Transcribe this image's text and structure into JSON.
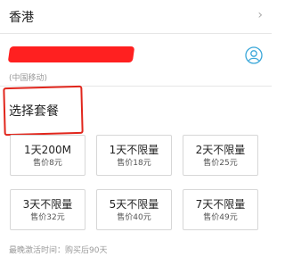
{
  "region": {
    "label": "香港",
    "chevron": "›"
  },
  "account": {
    "carrier": "(中国移动)",
    "icon": "user-circle-icon"
  },
  "plans": {
    "title": "选择套餐",
    "items": [
      {
        "name": "1天200M",
        "price": "售价8元"
      },
      {
        "name": "1天不限量",
        "price": "售价18元"
      },
      {
        "name": "2天不限量",
        "price": "售价25元"
      },
      {
        "name": "3天不限量",
        "price": "售价32元"
      },
      {
        "name": "5天不限量",
        "price": "售价40元"
      },
      {
        "name": "7天不限量",
        "price": "售价49元"
      }
    ]
  },
  "footer": {
    "activation_note": "最晚激活时间：购买后90天"
  },
  "colors": {
    "highlight": "#e1261c",
    "redaction": "#ff2020",
    "icon_accent": "#3aa7d9"
  }
}
